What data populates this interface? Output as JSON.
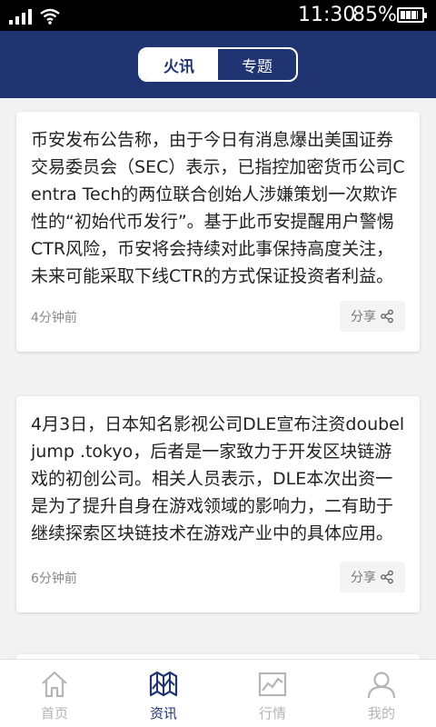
{
  "status_bar": {
    "time": "11:30",
    "battery": "85%",
    "battery_level": 0.85
  },
  "header": {
    "tabs": [
      {
        "label": "火讯",
        "active": true
      },
      {
        "label": "专题",
        "active": false
      }
    ]
  },
  "news": [
    {
      "text": "币安发布公告称，由于今日有消息爆出美国证券交易委员会（SEC）表示，已指控加密货币公司Centra Tech的两位联合创始人涉嫌策划一次欺诈性的“初始代币发行”。基于此币安提醒用户警惕CTR风险，币安将会持续对此事保持高度关注，未来可能采取下线CTR的方式保证投资者利益。",
      "time": "4分钟前",
      "share_label": "分享"
    },
    {
      "text": "4月3日，日本知名影视公司DLE宣布注资doubel jump .tokyo，后者是一家致力于开发区块链游戏的初创公司。相关人员表示，DLE本次出资一是为了提升自身在游戏领域的影响力，二有助于继续探索区块链技术在游戏产业中的具体应用。",
      "time": "6分钟前",
      "share_label": "分享"
    }
  ],
  "tabbar": {
    "items": [
      {
        "label": "首页",
        "icon": "home-icon",
        "active": false
      },
      {
        "label": "资讯",
        "icon": "map-icon",
        "active": true
      },
      {
        "label": "行情",
        "icon": "chart-icon",
        "active": false
      },
      {
        "label": "我的",
        "icon": "person-icon",
        "active": false
      }
    ]
  },
  "colors": {
    "header_bg": "#1f3470",
    "active_tab": "#1f3470",
    "inactive_tab": "#b5b5b5"
  }
}
